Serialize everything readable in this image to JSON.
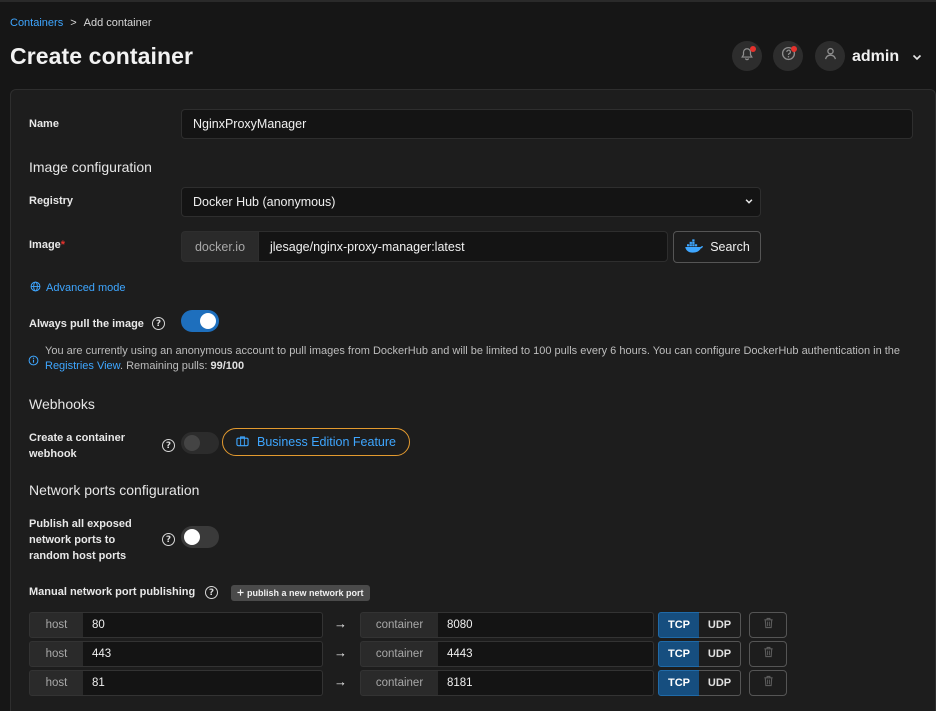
{
  "breadcrumb": {
    "parent": "Containers",
    "separator": ">",
    "current": "Add container"
  },
  "page": {
    "title": "Create container"
  },
  "header": {
    "user_name": "admin"
  },
  "form": {
    "name_label": "Name",
    "name_value": "NginxProxyManager",
    "image_section": "Image configuration",
    "registry_label": "Registry",
    "registry_value": "Docker Hub (anonymous)",
    "image_label": "Image",
    "image_required_mark": "*",
    "image_prefix": "docker.io",
    "image_value": "jlesage/nginx-proxy-manager:latest",
    "search_label": "Search",
    "advanced_mode": "Advanced mode",
    "always_pull_label": "Always pull the image",
    "always_pull_enabled": true,
    "info_text_1": "You are currently using an anonymous account to pull images from DockerHub and will be limited to 100 pulls every 6 hours. You can configure DockerHub authentication in the",
    "info_link": "Registries View",
    "info_text_2": ". Remaining pulls: ",
    "info_remaining": "99/100",
    "webhooks_section": "Webhooks",
    "webhook_label_line1": "Create a container",
    "webhook_label_line2": "webhook",
    "business_feature": "Business Edition Feature",
    "network_section": "Network ports configuration",
    "publish_all_line1": "Publish all exposed",
    "publish_all_line2": "network ports to",
    "publish_all_line3": "random host ports",
    "publish_all_enabled": false,
    "manual_publishing_label": "Manual network port publishing",
    "publish_new_port": "publish a new network port"
  },
  "ports": {
    "host_label": "host",
    "container_label": "container",
    "arrow": "→",
    "tcp_label": "TCP",
    "udp_label": "UDP",
    "rows": [
      {
        "host": "80",
        "container": "8080",
        "protocol": "TCP"
      },
      {
        "host": "443",
        "container": "4443",
        "protocol": "TCP"
      },
      {
        "host": "81",
        "container": "8181",
        "protocol": "TCP"
      }
    ]
  },
  "colors": {
    "accent": "#3ea6ff",
    "toggle_on": "#1e6fbd",
    "business_border": "#e39a2f",
    "tcp_active": "#164e7f"
  }
}
